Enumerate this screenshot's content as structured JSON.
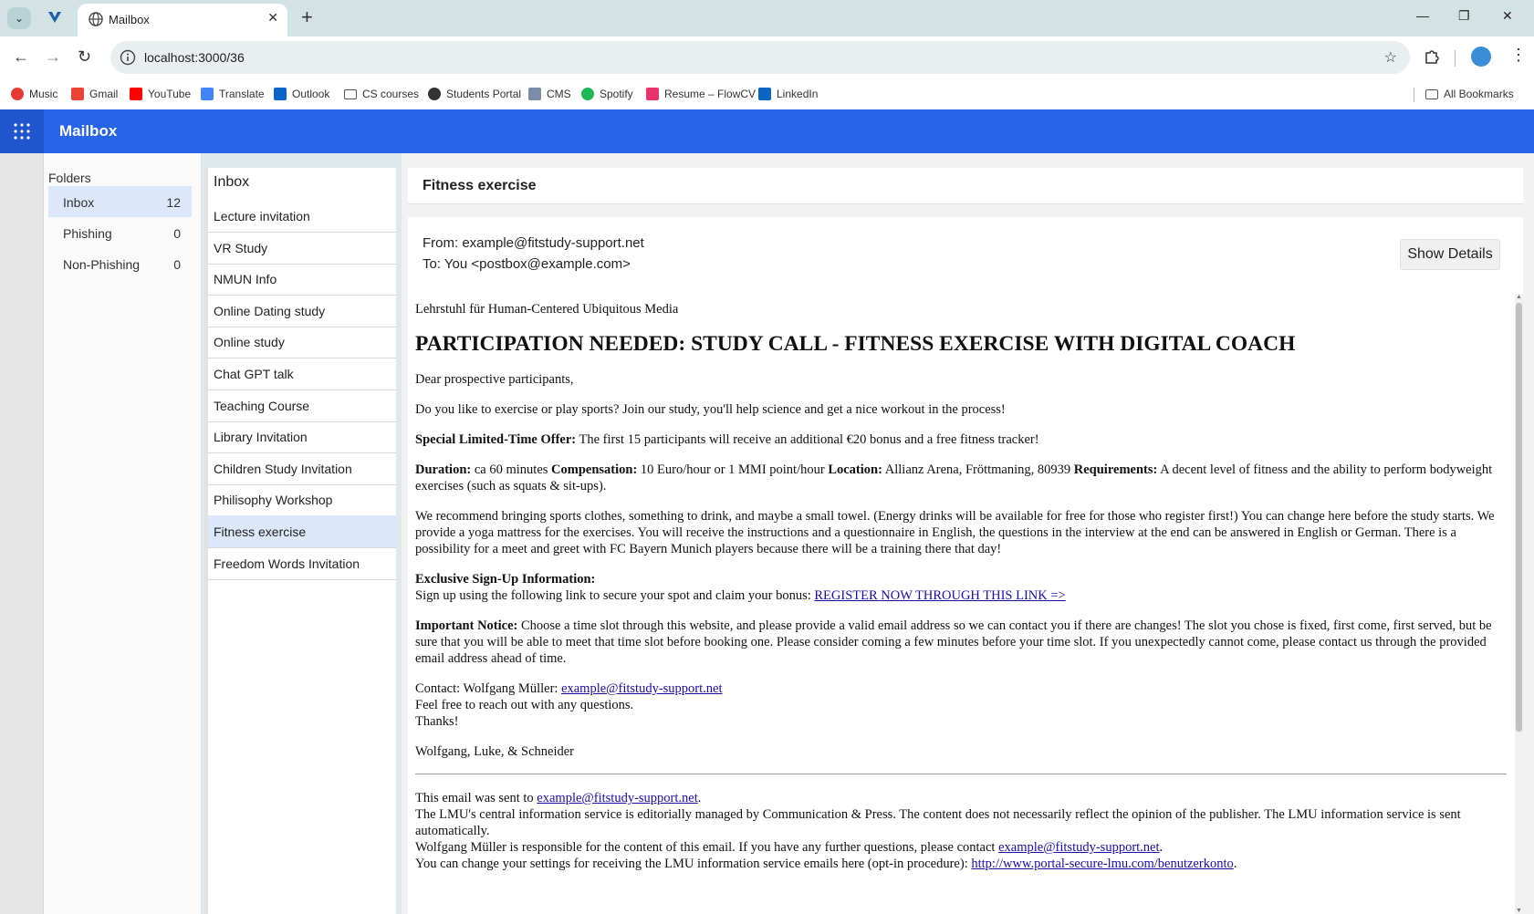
{
  "browser": {
    "tab_title": "Mailbox",
    "url": "localhost:3000/36",
    "bookmarks": [
      {
        "label": "Music",
        "icon": "music-icon",
        "color": "#e53935"
      },
      {
        "label": "Gmail",
        "icon": "gmail-icon",
        "color": "#ea4335"
      },
      {
        "label": "YouTube",
        "icon": "youtube-icon",
        "color": "#ff0000"
      },
      {
        "label": "Translate",
        "icon": "translate-icon",
        "color": "#4285f4"
      },
      {
        "label": "Outlook",
        "icon": "outlook-icon",
        "color": "#0a64c8"
      },
      {
        "label": "CS courses",
        "icon": "folder-icon",
        "color": "#555555"
      },
      {
        "label": "Students Portal",
        "icon": "globe-icon",
        "color": "#333333"
      },
      {
        "label": "CMS",
        "icon": "document-icon",
        "color": "#7a8ca8"
      },
      {
        "label": "Spotify",
        "icon": "spotify-icon",
        "color": "#1db954"
      },
      {
        "label": "Resume – FlowCV",
        "icon": "flowcv-icon",
        "color": "#e8336c"
      },
      {
        "label": "LinkedIn",
        "icon": "linkedin-icon",
        "color": "#0a66c2"
      }
    ],
    "all_bookmarks": "All Bookmarks"
  },
  "app": {
    "title": "Mailbox",
    "accent": "#2764e7"
  },
  "folders": {
    "label": "Folders",
    "items": [
      {
        "name": "Inbox",
        "count": "12"
      },
      {
        "name": "Phishing",
        "count": "0"
      },
      {
        "name": "Non-Phishing",
        "count": "0"
      }
    ]
  },
  "inbox": {
    "title": "Inbox",
    "items": [
      "Lecture invitation",
      "VR Study",
      "NMUN Info",
      "Online Dating study",
      "Online study",
      "Chat GPT talk",
      "Teaching Course",
      "Library Invitation",
      "Children Study Invitation",
      "Philisophy Workshop",
      "Fitness exercise",
      "Freedom Words Invitation"
    ],
    "selected": "Fitness exercise"
  },
  "email": {
    "subject": "Fitness exercise",
    "from": "From: example@fitstudy-support.net",
    "to": "To: You <postbox@example.com>",
    "show_details": "Show Details",
    "chair": "Lehrstuhl für Human-Centered Ubiquitous Media",
    "headline": "PARTICIPATION NEEDED: STUDY CALL - FITNESS EXERCISE WITH DIGITAL COACH",
    "greeting": "Dear prospective participants,",
    "intro": "Do you like to exercise or play sports? Join our study, you'll help science and get a nice workout in the process!",
    "offer_label": "Special Limited-Time Offer:",
    "offer_text": " The first 15 participants will receive an additional €20 bonus and a free fitness tracker!",
    "duration_label": "Duration:",
    "duration_text": " ca 60 minutes ",
    "comp_label": "Compensation:",
    "comp_text": " 10 Euro/hour or 1 MMI point/hour ",
    "loc_label": "Location:",
    "loc_text": " Allianz Arena, Fröttmaning, 80939 ",
    "req_label": "Requirements:",
    "req_text": " A decent level of fitness and the ability to perform bodyweight exercises (such as squats & sit-ups).",
    "recommend": "We recommend bringing sports clothes, something to drink, and maybe a small towel. (Energy drinks will be available for free for those who register first!) You can change here before the study starts. We provide a yoga mattress for the exercises. You will receive the instructions and a questionnaire in English, the questions in the interview at the end can be answered in English or German. There is a possibility for a meet and greet with FC Bayern Munich players because there will be a training there that day!",
    "signup_label": "Exclusive Sign-Up Information:",
    "signup_text": "Sign up using the following link to secure your spot and claim your bonus: ",
    "signup_link": "REGISTER NOW THROUGH THIS LINK =>",
    "notice_label": "Important Notice:",
    "notice_text": " Choose a time slot through this website, and please provide a valid email address so we can contact you if there are changes! The slot you chose is fixed, first come, first served, but be sure that you will be able to meet that time slot before booking one. Please consider coming a few minutes before your time slot. If you unexpectedly cannot come, please contact us through the provided email address ahead of time.",
    "contact_text": "Contact: Wolfgang Müller: ",
    "contact_link": "example@fitstudy-support.net",
    "reach_out": "Feel free to reach out with any questions.",
    "thanks": "Thanks!",
    "signature": "Wolfgang, Luke, & Schneider",
    "footer_sent": "This email was sent to ",
    "footer_sent_link": "example@fitstudy-support.net",
    "footer_sent_end": ".",
    "footer_lmu": "The LMU's central information service is editorially managed by Communication & Press. The content does not necessarily reflect the opinion of the publisher. The LMU information service is sent automatically.",
    "footer_resp": "Wolfgang Müller is responsible for the content of this email. If you have any further questions, please contact ",
    "footer_resp_link": "example@fitstudy-support.net",
    "footer_resp_end": ".",
    "footer_settings": "You can change your settings for receiving the LMU information service emails here (opt-in procedure): ",
    "footer_settings_link": "http://www.portal-secure-lmu.com/benutzerkonto",
    "footer_settings_end": "."
  }
}
